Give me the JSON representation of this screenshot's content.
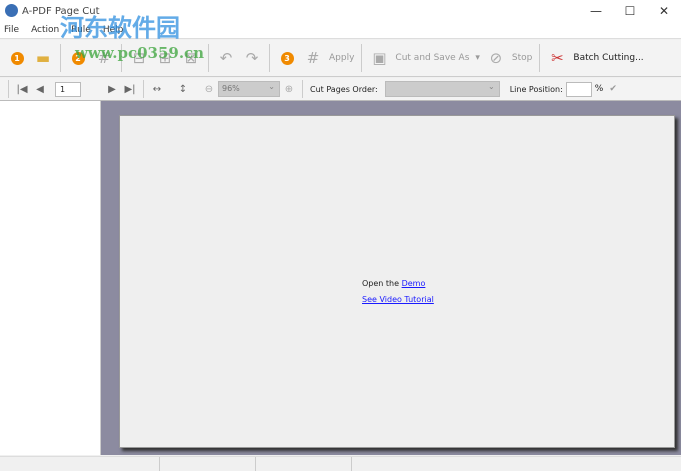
{
  "window": {
    "title": "A-PDF Page Cut",
    "minimize": "—",
    "maximize": "☐",
    "close": "✕"
  },
  "menu": [
    "File",
    "Action",
    "Rule",
    "Help"
  ],
  "toolbar": {
    "step1": "1",
    "step2": "2",
    "step3": "3",
    "apply": "Apply",
    "cut_save": "Cut and Save As",
    "stop": "Stop",
    "batch": "Batch Cutting..."
  },
  "nav": {
    "page": "1",
    "zoom": "96%",
    "cut_order_label": "Cut Pages Order:",
    "cut_order_value": "",
    "line_pos_label": "Line Position:",
    "line_pos_value": "",
    "percent": "%"
  },
  "content": {
    "open_text": "Open the",
    "demo_link": "Demo",
    "video_link": "See Video Tutorial"
  },
  "watermark": {
    "line1": "河东软件园",
    "line2": "www.pc0359.cn"
  }
}
